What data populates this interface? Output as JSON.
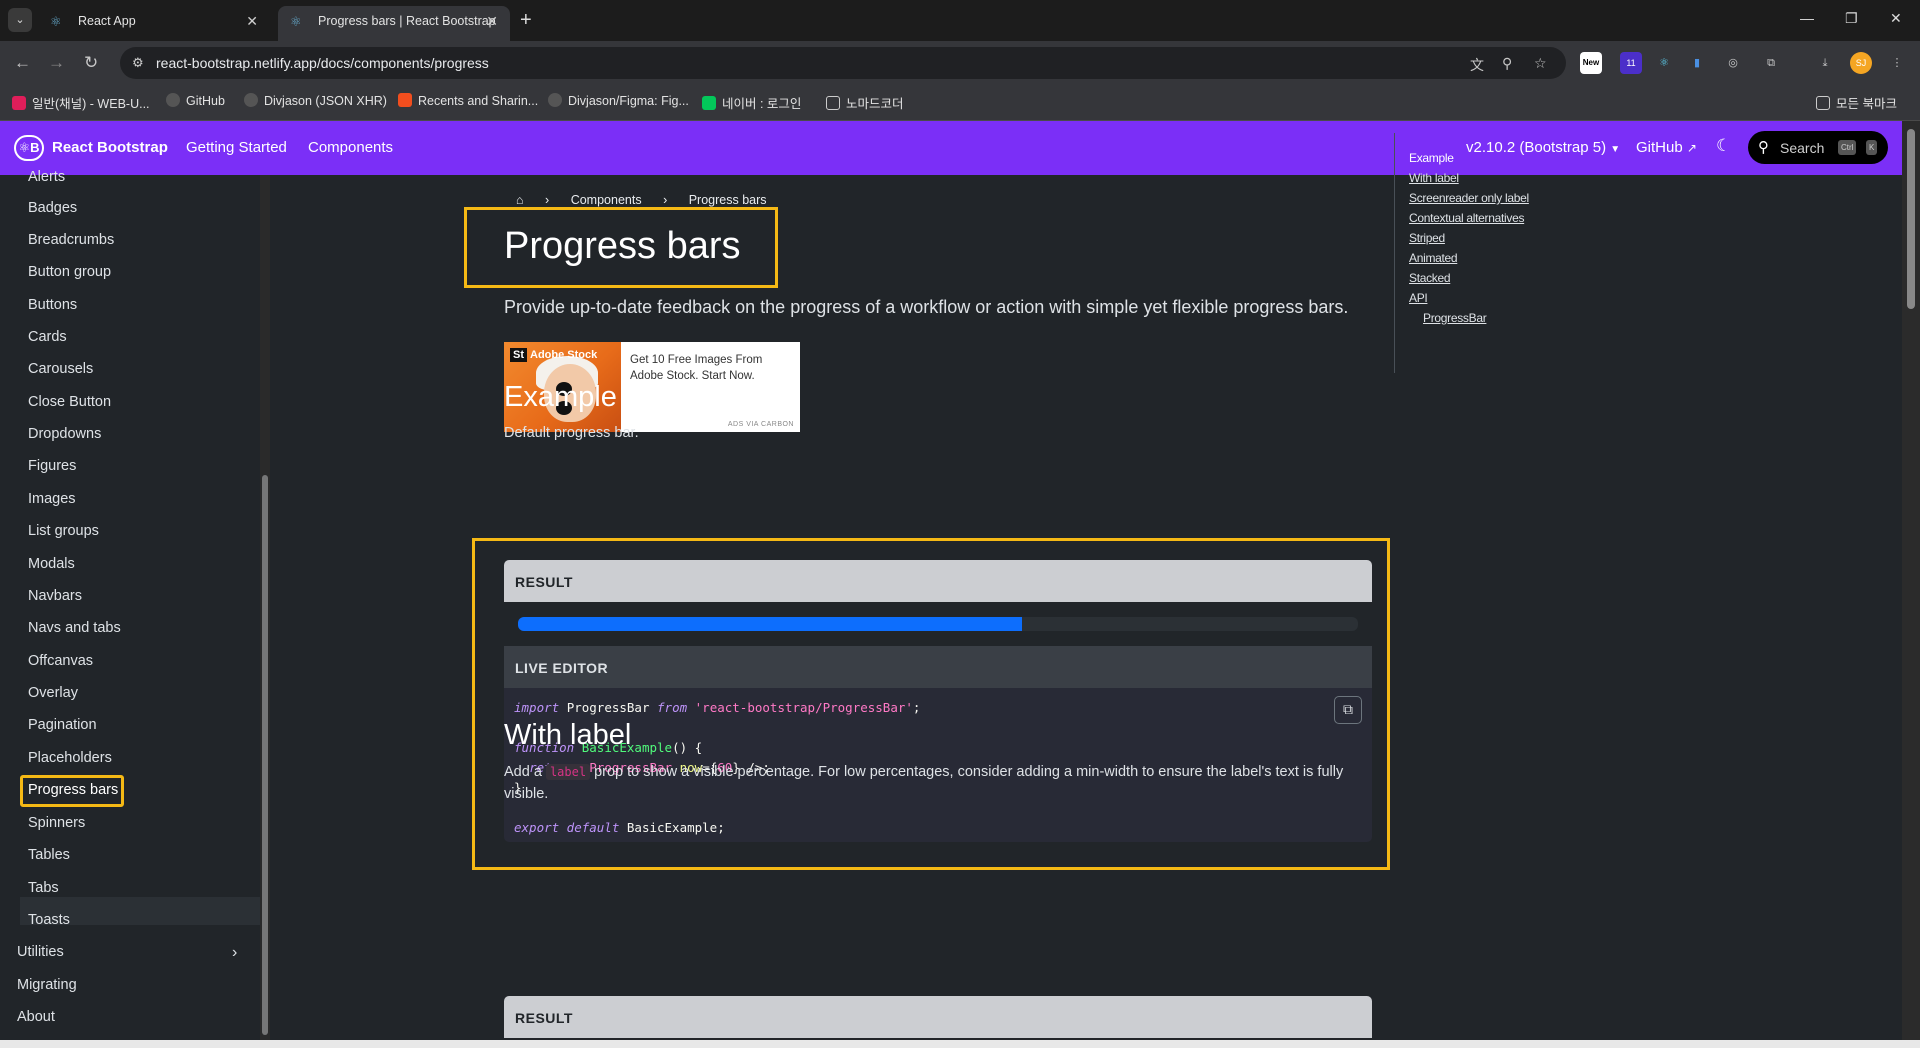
{
  "browser": {
    "tabs": [
      {
        "title": "React App",
        "active": false
      },
      {
        "title": "Progress bars | React Bootstrap",
        "active": true
      }
    ],
    "url": "react-bootstrap.netlify.app/docs/components/progress",
    "extension_new_badge": "New",
    "extension_count_badge": "11",
    "profile_initials": "SJ",
    "bookmarks": [
      "일반(채널) - WEB-U...",
      "GitHub",
      "Divjason (JSON XHR)",
      "Recents and Sharin...",
      "Divjason/Figma: Fig...",
      "네이버 : 로그인",
      "노마드코더"
    ],
    "all_bookmarks": "모든 북마크"
  },
  "navbar": {
    "brand": "React Bootstrap",
    "links": [
      "Getting Started",
      "Components"
    ],
    "version": "v2.10.2 (Bootstrap 5)",
    "github": "GitHub",
    "search_label": "Search",
    "search_kbd": [
      "Ctrl",
      "K"
    ]
  },
  "sidebar": {
    "items": [
      "Alerts",
      "Badges",
      "Breadcrumbs",
      "Button group",
      "Buttons",
      "Cards",
      "Carousels",
      "Close Button",
      "Dropdowns",
      "Figures",
      "Images",
      "List groups",
      "Modals",
      "Navbars",
      "Navs and tabs",
      "Offcanvas",
      "Overlay",
      "Pagination",
      "Placeholders",
      "Progress bars",
      "Spinners",
      "Tables",
      "Tabs",
      "Toasts"
    ],
    "active": "Progress bars",
    "top_level": [
      "Utilities",
      "Migrating",
      "About"
    ]
  },
  "breadcrumb": {
    "home_icon": "home-icon",
    "items": [
      "Components",
      "Progress bars"
    ]
  },
  "main": {
    "title": "Progress bars",
    "lead": "Provide up-to-date feedback on the progress of a workflow or action with simple yet flexible progress bars.",
    "ad": {
      "brand_mark": "St",
      "brand_name": "Adobe Stock",
      "text": "Get 10 Free Images From Adobe Stock. Start Now.",
      "via": "ADS VIA CARBON"
    },
    "example_heading": "Example",
    "example_desc": "Default progress bar.",
    "result_label": "RESULT",
    "progress_value_percent": 60,
    "live_editor_label": "LIVE EDITOR",
    "code": {
      "import_kw": "import",
      "import_name": "ProgressBar",
      "from_kw": "from",
      "import_path": "'react-bootstrap/ProgressBar'",
      "function_kw": "function",
      "function_name": "BasicExample",
      "return_kw": "return",
      "component": "ProgressBar",
      "prop": "now",
      "prop_value": "60",
      "export_kw": "export default",
      "export_name": "BasicExample"
    },
    "with_label_heading": "With label",
    "with_label_text_before": "Add a",
    "with_label_code": "label",
    "with_label_text_after": "prop to show a visible percentage. For low percentages, consider adding a min-width to ensure the label's text is fully visible.",
    "result_label_2": "RESULT"
  },
  "toc": {
    "items": [
      "Example",
      "With label",
      "Screenreader only label",
      "Contextual alternatives",
      "Striped",
      "Animated",
      "Stacked",
      "API"
    ],
    "sub_items": [
      "ProgressBar"
    ]
  },
  "colors": {
    "navbar": "#7b2ff7",
    "highlight": "#f5b915",
    "progress": "#0d6efd",
    "background": "#212529"
  }
}
